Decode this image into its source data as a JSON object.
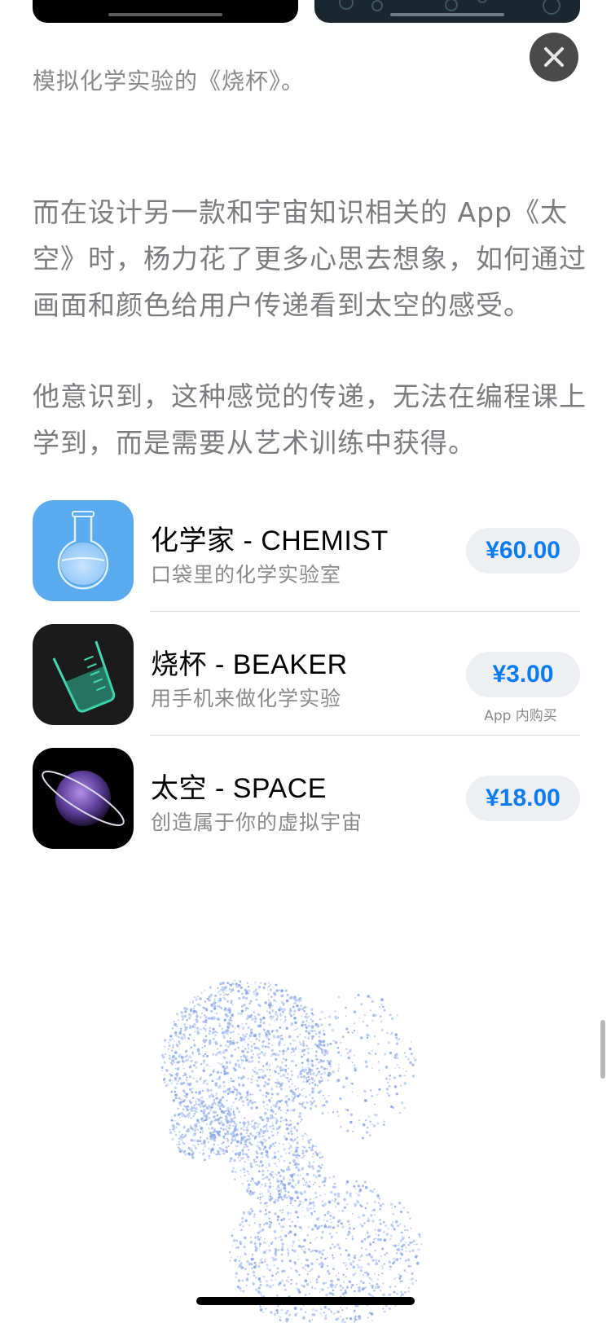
{
  "caption": "模拟化学实验的《烧杯》。",
  "paragraphs": [
    "而在设计另一款和宇宙知识相关的 App《太空》时，杨力花了更多心思去想象，如何通过画面和颜色给用户传递看到太空的感受。",
    "他意识到，这种感觉的传递，无法在编程课上学到，而是需要从艺术训练中获得。"
  ],
  "apps": [
    {
      "name": "化学家 - CHEMIST",
      "subtitle": "口袋里的化学实验室",
      "price": "¥60.00",
      "icon": "chemistry-flask-icon"
    },
    {
      "name": "烧杯 - BEAKER",
      "subtitle": "用手机来做化学实验",
      "price": "¥3.00",
      "note": "App 内购买",
      "icon": "beaker-icon"
    },
    {
      "name": "太空 - SPACE",
      "subtitle": "创造属于你的虚拟宇宙",
      "price": "¥18.00",
      "icon": "planet-icon"
    }
  ],
  "colors": {
    "price": "#0a7cf2",
    "price_bg": "#eeeff3",
    "body_text": "#7c7c80",
    "chemist_icon_bg": "#5aaaf0",
    "beaker_icon_bg": "#1b1b1b",
    "space_icon_bg": "#000000"
  },
  "icons": {
    "close": "close-icon",
    "art": "particle-head-illustration"
  }
}
